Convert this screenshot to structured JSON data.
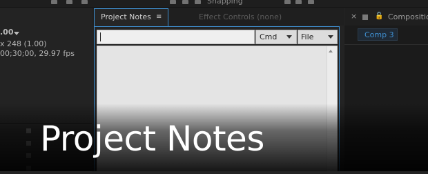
{
  "toolbar": {
    "snapping_label": "Snapping"
  },
  "project_panel": {
    "size_label": ".00",
    "dimensions_line": "x 248 (1.00)",
    "duration_line": "00;30;00, 29.97 fps"
  },
  "project_notes_panel": {
    "tab_label": "Project Notes",
    "tab_menu_glyph": "≡",
    "inactive_tab_label": "Effect Controls (none)",
    "search": {
      "value": "",
      "placeholder": ""
    },
    "cmd_dropdown": {
      "selected": "Cmd"
    },
    "file_dropdown": {
      "selected": "File"
    }
  },
  "composition_panel": {
    "close_glyph": "×",
    "lock_glyph": "🔓",
    "title": "Composition",
    "comp_button_label": "Comp 3"
  },
  "overlay": {
    "title": "Project Notes"
  },
  "colors": {
    "accent": "#3f8fd0",
    "panel_bg": "#232323",
    "notes_bg": "#e4e4e4"
  },
  "icons": [
    "menu-icon",
    "dropdown-arrow-icon",
    "close-icon",
    "lock-icon",
    "scroll-up-icon"
  ]
}
